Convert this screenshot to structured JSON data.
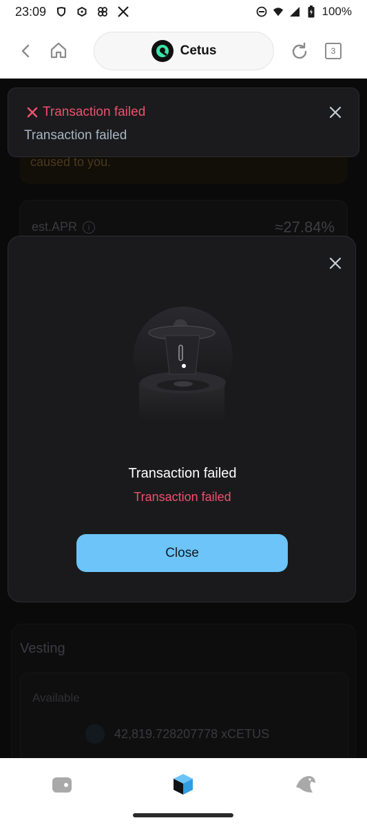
{
  "status_bar": {
    "time": "23:09",
    "battery": "100%",
    "left_icons": [
      "shield-icon",
      "hexagon-icon",
      "pinwheel-icon",
      "x-logo-icon"
    ],
    "right_icons": [
      "do-not-disturb-icon",
      "wifi-icon",
      "signal-icon",
      "battery-icon"
    ]
  },
  "browser": {
    "site_name": "Cetus",
    "tab_count": "3"
  },
  "page": {
    "notice_text": "caused to you.",
    "apr_label": "est.APR",
    "apr_value": "≈27.84%",
    "vesting_title": "Vesting",
    "available_label": "Available",
    "balance": "42,819.728207778 xCETUS"
  },
  "toast": {
    "title": "Transaction failed",
    "message": "Transaction failed"
  },
  "modal": {
    "title": "Transaction failed",
    "subtitle": "Transaction failed",
    "close_label": "Close"
  },
  "colors": {
    "error": "#f0506e",
    "accent_button": "#6cc4f8",
    "modal_bg": "#1a1a1c"
  }
}
